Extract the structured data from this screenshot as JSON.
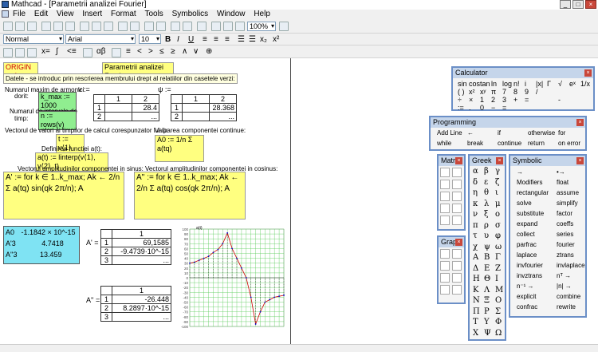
{
  "window": {
    "title": "Mathcad - [Parametrii analizei Fourier]"
  },
  "menu": [
    "File",
    "Edit",
    "View",
    "Insert",
    "Format",
    "Tools",
    "Symbolics",
    "Window",
    "Help"
  ],
  "format": {
    "style": "Normal",
    "font": "Arial",
    "size": "10",
    "zoom": "100%"
  },
  "worksheet": {
    "origin": "ORIGIN := 1",
    "title_box": "Parametrii analizei Fourier",
    "instructions": "Datele - se introduc prin rescrierea membrului drept al relatiilor din casetele verzi:",
    "harm_label1": "Numarul maxim de armonici",
    "harm_label2": "dorit:",
    "kmax": "k_max := 1000",
    "interv_label1": "Numarul de intervale de",
    "interv_label2": "timp:",
    "n_def": "n := rows(v)",
    "v_label": "v :=",
    "v_table": {
      "cols": [
        "1",
        "2"
      ],
      "rows": [
        [
          "1",
          "",
          "28.4"
        ],
        [
          "2",
          "",
          "..."
        ]
      ]
    },
    "w_label": "ψ :=",
    "w_table": {
      "cols": [
        "1",
        "2"
      ],
      "rows": [
        [
          "1",
          "",
          "28.368"
        ],
        [
          "2",
          "",
          "..."
        ]
      ]
    },
    "vec_text": "Vectorul de valori ai timpilor de calcul corespunzator lui ψ:",
    "t_def": "t := v⟨1⟩",
    "fn_text": "Definirea functiei a(t):",
    "a_def": "a(t) := linterp(v⟨1⟩, v⟨2⟩, t)",
    "cont_text": "Valoarea componentei continue:",
    "a0_def": "A0 := 1/n Σ a(tq)",
    "sin_text": "Vectorul amplitudinilor componentei in sinus:",
    "cos_text": "Vectorul amplitudinilor componentei in cosinus:",
    "sin_prog": "A' := for k ∈ 1..k_max; Ak ← 2/n Σ a(tq) sin(qk 2π/n); A",
    "cos_prog": "A'' := for k ∈ 1..k_max; Ak ← 2/n Σ a(tq) cos(qk 2π/n); A",
    "result_vec": [
      "-1.1842 × 10^-15",
      "4.7418",
      "13.459"
    ],
    "result_lhs": [
      "A0",
      "A'3",
      "A''3"
    ],
    "a1_label": "A' =",
    "a1_table": {
      "cols": [
        "1"
      ],
      "rows": [
        [
          "1",
          "69,1585"
        ],
        [
          "2",
          "-9.4739·10^-15"
        ],
        [
          "3",
          "..."
        ]
      ]
    },
    "a2_label": "A'' =",
    "a2_table": {
      "cols": [
        "1"
      ],
      "rows": [
        [
          "1",
          "-26.448"
        ],
        [
          "2",
          "8.2897·10^-15"
        ],
        [
          "3",
          "..."
        ]
      ]
    },
    "plot_ylabel": "a(t)"
  },
  "chart_data": {
    "type": "line",
    "ylabel": "a(t)",
    "ylim": [
      -100,
      100
    ],
    "yticks": [
      100,
      90,
      80,
      70,
      60,
      50,
      40,
      30,
      20,
      10,
      0,
      -10,
      -20,
      -30,
      -40,
      -50,
      -60,
      -70,
      -80,
      -90,
      -100
    ],
    "xlim": [
      0,
      20
    ],
    "series": [
      {
        "x": [
          0,
          1,
          2,
          3,
          4,
          5,
          6,
          7,
          8,
          9,
          10,
          11,
          12,
          13,
          14,
          15,
          16,
          17,
          18,
          19,
          20
        ],
        "values": [
          30,
          32,
          36,
          40,
          44,
          52,
          58,
          70,
          92,
          60,
          40,
          20,
          0,
          -40,
          -95,
          -70,
          -50,
          -45,
          -40,
          -38,
          -36
        ]
      }
    ],
    "grid": true
  },
  "calculator": {
    "title": "Calculator",
    "rows": [
      [
        "sin",
        "cos",
        "tan",
        "ln",
        "log",
        "n!",
        "i",
        "|x|",
        "Γ",
        "√",
        "eˣ",
        "1/x"
      ],
      [
        "( )",
        "x²",
        "xʸ",
        "π",
        "7",
        "8",
        "9",
        "/",
        "",
        ""
      ],
      [
        "÷",
        "×",
        "1",
        "2",
        "3",
        "+",
        "=",
        "",
        "",
        "-"
      ],
      [
        ":=",
        ".",
        "0",
        "−",
        "=",
        ""
      ]
    ]
  },
  "programming": {
    "title": "Programming",
    "rows": [
      [
        "Add Line",
        "←",
        "if",
        "otherwise",
        "for"
      ],
      [
        "while",
        "break",
        "continue",
        "return",
        "on error"
      ]
    ]
  },
  "matrix": {
    "title": "Matrix"
  },
  "graph": {
    "title": "Graph"
  },
  "greek": {
    "title": "Greek",
    "letters": [
      "α",
      "β",
      "γ",
      "δ",
      "ε",
      "ζ",
      "η",
      "θ",
      "ι",
      "κ",
      "λ",
      "μ",
      "ν",
      "ξ",
      "ο",
      "π",
      "ρ",
      "σ",
      "τ",
      "υ",
      "φ",
      "χ",
      "ψ",
      "ω",
      "Α",
      "Β",
      "Γ",
      "Δ",
      "Ε",
      "Ζ",
      "Η",
      "Θ",
      "Ι",
      "Κ",
      "Λ",
      "Μ",
      "Ν",
      "Ξ",
      "Ο",
      "Π",
      "Ρ",
      "Σ",
      "Τ",
      "Υ",
      "Φ",
      "Χ",
      "Ψ",
      "Ω"
    ]
  },
  "symbolic": {
    "title": "Symbolic",
    "items": [
      [
        "→",
        "•→"
      ],
      [
        "Modifiers",
        "float"
      ],
      [
        "rectangular",
        "assume"
      ],
      [
        "solve",
        "simplify"
      ],
      [
        "substitute",
        "factor"
      ],
      [
        "expand",
        "coeffs"
      ],
      [
        "collect",
        "series"
      ],
      [
        "parfrac",
        "fourier"
      ],
      [
        "laplace",
        "ztrans"
      ],
      [
        "invfourier",
        "invlaplace"
      ],
      [
        "invztrans",
        "nᵀ →"
      ],
      [
        "n⁻¹ →",
        "|n| →"
      ],
      [
        "explicit",
        "combine"
      ],
      [
        "confrac",
        "rewrite"
      ]
    ]
  }
}
